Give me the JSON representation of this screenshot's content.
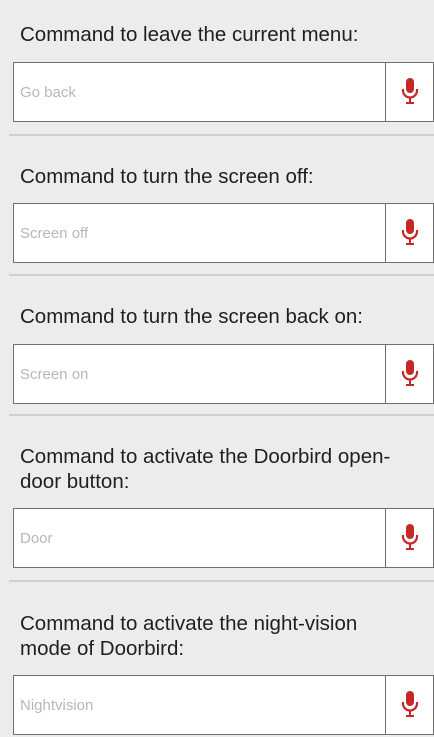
{
  "accent_color": "#c62828",
  "icons": {
    "microphone": "microphone-icon"
  },
  "settings": [
    {
      "label": "Command to leave the current menu:",
      "placeholder": "Go back"
    },
    {
      "label": "Command to turn the screen off:",
      "placeholder": "Screen off"
    },
    {
      "label": "Command to turn the screen back on:",
      "placeholder": "Screen on"
    },
    {
      "label": "Command to activate the Doorbird open-door button:",
      "placeholder": "Door"
    },
    {
      "label": "Command to activate the night-vision mode of Doorbird:",
      "placeholder": "Nightvision"
    }
  ]
}
